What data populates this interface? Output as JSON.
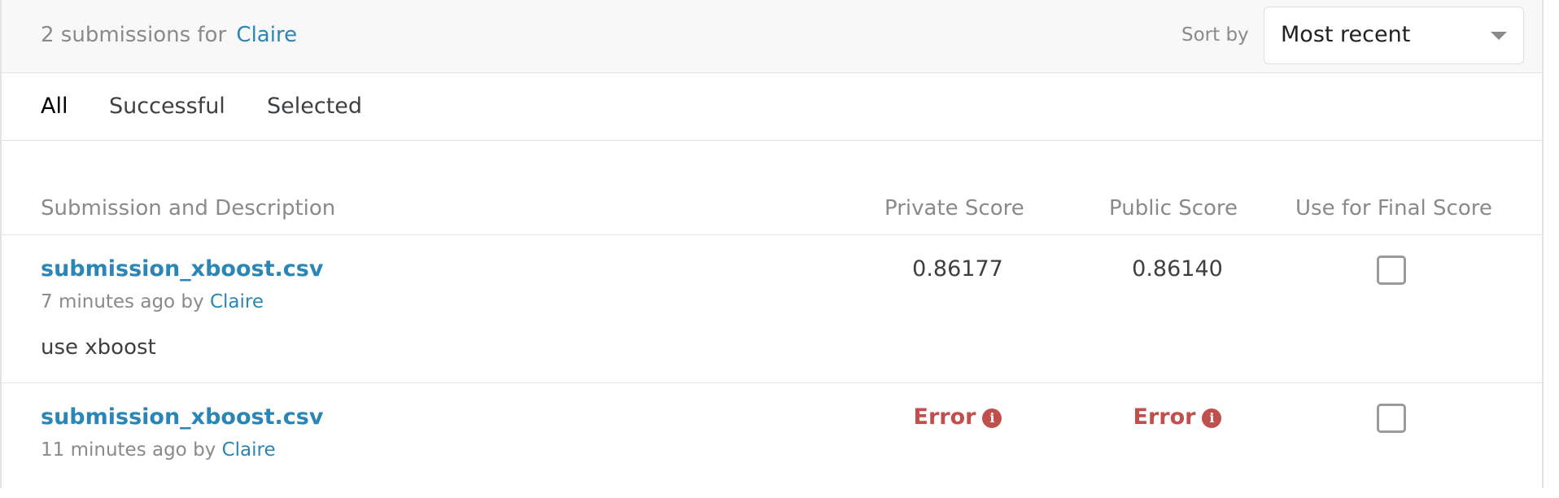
{
  "header": {
    "count_text": "2 submissions for",
    "user": "Claire",
    "sort_label": "Sort by",
    "sort_value": "Most recent"
  },
  "tabs": [
    {
      "label": "All",
      "active": true
    },
    {
      "label": "Successful",
      "active": false
    },
    {
      "label": "Selected",
      "active": false
    }
  ],
  "table": {
    "columns": {
      "submission": "Submission and Description",
      "private": "Private Score",
      "public": "Public Score",
      "final": "Use for Final Score"
    },
    "rows": [
      {
        "file": "submission_xboost.csv",
        "time": "7 minutes ago by",
        "user": "Claire",
        "description": "use xboost",
        "private_score": "0.86177",
        "public_score": "0.86140",
        "selected": false
      },
      {
        "file": "submission_xboost.csv",
        "time": "11 minutes ago by",
        "user": "Claire",
        "description": "",
        "private_score": "Error",
        "public_score": "Error",
        "selected": false
      }
    ]
  },
  "icons": {
    "error_info": "info-icon",
    "sort_caret": "chevron-down-icon"
  },
  "colors": {
    "link": "#2b86b5",
    "error": "#c0504d",
    "muted": "#8a8a8a"
  }
}
